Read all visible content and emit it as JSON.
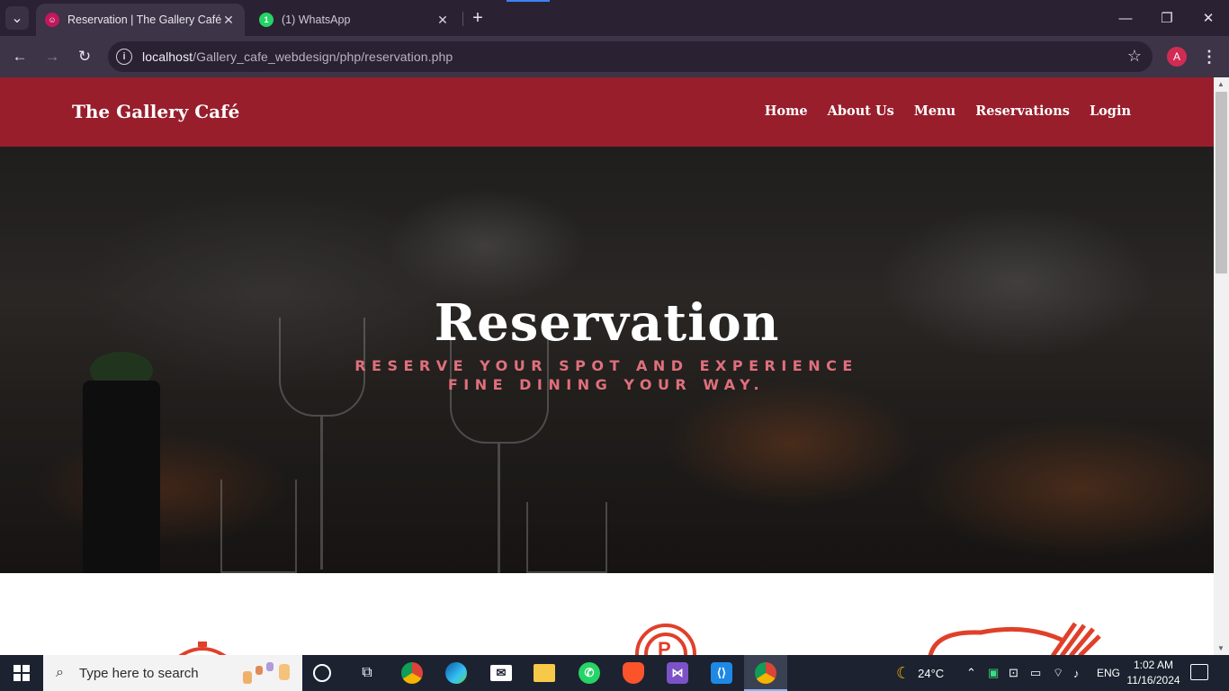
{
  "browser": {
    "tabs": [
      {
        "title": "Reservation | The Gallery Café",
        "active": true
      },
      {
        "title": "(1) WhatsApp",
        "active": false
      }
    ],
    "url_host": "localhost",
    "url_path": "/Gallery_cafe_webdesign/php/reservation.php",
    "profile_initial": "A"
  },
  "site": {
    "brand": "The Gallery Café",
    "nav": [
      "Home",
      "About Us",
      "Menu",
      "Reservations",
      "Login"
    ],
    "hero_title": "Reservation",
    "hero_subtitle": "Reserve your spot and experience fine dining your way.",
    "colors": {
      "header": "#981e2c",
      "subtitle": "#e0707c",
      "icons": "#e0402a"
    }
  },
  "taskbar": {
    "search_placeholder": "Type here to search",
    "weather": "24°C",
    "language": "ENG",
    "time": "1:02 AM",
    "date": "11/16/2024"
  }
}
